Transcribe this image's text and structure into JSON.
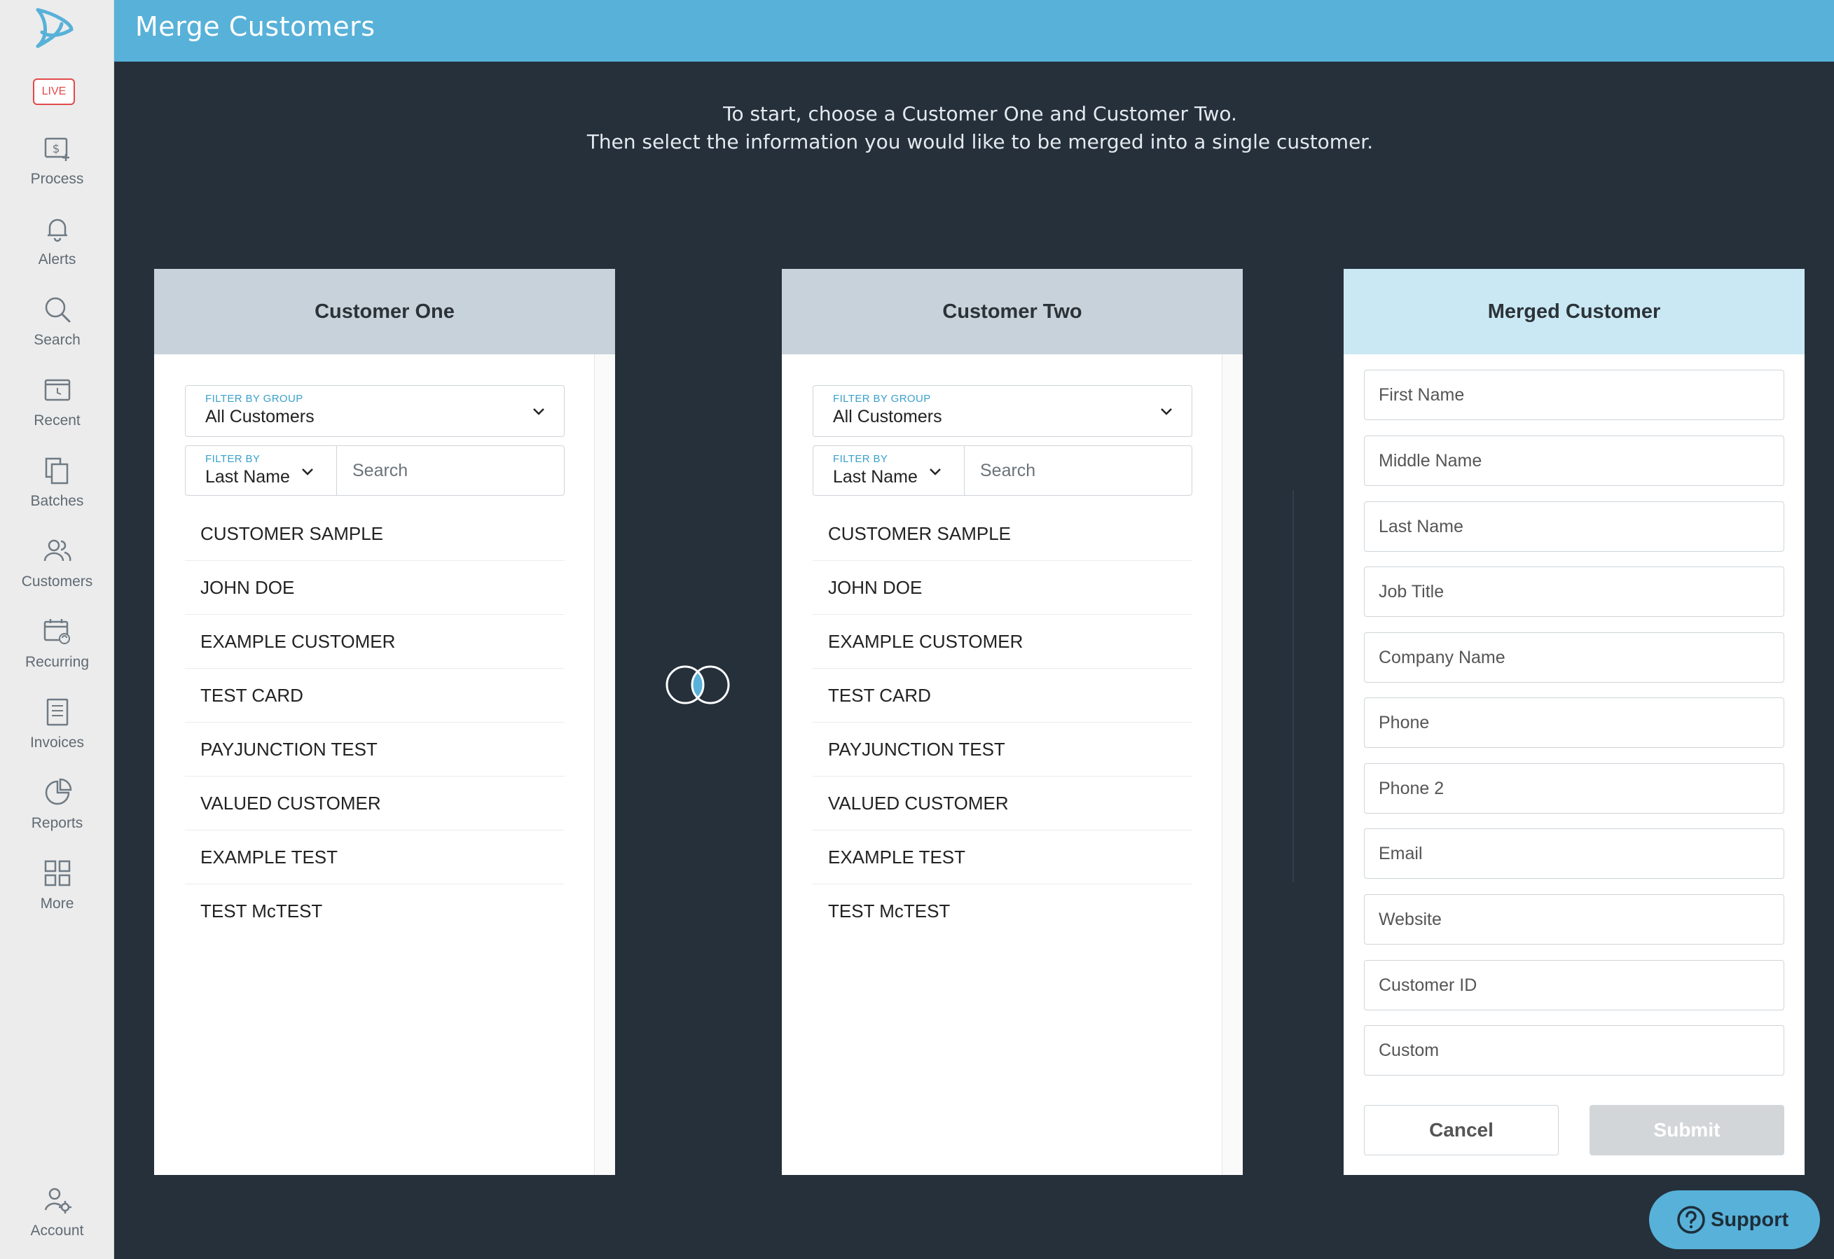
{
  "sidebar": {
    "live_badge": "LIVE",
    "items": [
      {
        "label": "Process",
        "icon": "process-icon"
      },
      {
        "label": "Alerts",
        "icon": "bell-icon"
      },
      {
        "label": "Search",
        "icon": "search-icon"
      },
      {
        "label": "Recent",
        "icon": "recent-icon"
      },
      {
        "label": "Batches",
        "icon": "batches-icon"
      },
      {
        "label": "Customers",
        "icon": "customers-icon"
      },
      {
        "label": "Recurring",
        "icon": "recurring-icon"
      },
      {
        "label": "Invoices",
        "icon": "invoices-icon"
      },
      {
        "label": "Reports",
        "icon": "reports-icon"
      },
      {
        "label": "More",
        "icon": "grid-icon"
      }
    ],
    "account_label": "Account"
  },
  "header": {
    "title": "Merge Customers"
  },
  "intro": {
    "line1": "To start, choose a Customer One and Customer Two.",
    "line2": "Then select the information you would like to be merged into a single customer."
  },
  "panels": {
    "one": {
      "title": "Customer One",
      "group_label": "FILTER BY GROUP",
      "group_value": "All Customers",
      "filter_label": "FILTER BY",
      "filter_value": "Last Name",
      "search_placeholder": "Search",
      "customers": [
        "CUSTOMER SAMPLE",
        "JOHN DOE",
        "EXAMPLE CUSTOMER",
        "TEST CARD",
        "PAYJUNCTION TEST",
        "VALUED CUSTOMER",
        "EXAMPLE TEST",
        "TEST McTEST"
      ]
    },
    "two": {
      "title": "Customer Two",
      "group_label": "FILTER BY GROUP",
      "group_value": "All Customers",
      "filter_label": "FILTER BY",
      "filter_value": "Last Name",
      "search_placeholder": "Search",
      "customers": [
        "CUSTOMER SAMPLE",
        "JOHN DOE",
        "EXAMPLE CUSTOMER",
        "TEST CARD",
        "PAYJUNCTION TEST",
        "VALUED CUSTOMER",
        "EXAMPLE TEST",
        "TEST McTEST"
      ]
    }
  },
  "merged": {
    "title": "Merged Customer",
    "fields": [
      "First Name",
      "Middle Name",
      "Last Name",
      "Job Title",
      "Company Name",
      "Phone",
      "Phone 2",
      "Email",
      "Website",
      "Customer ID",
      "Custom"
    ],
    "cancel_label": "Cancel",
    "submit_label": "Submit"
  },
  "support_label": "Support",
  "colors": {
    "accent": "#58b1d8",
    "background": "#25303b",
    "live": "#e04a4a"
  }
}
